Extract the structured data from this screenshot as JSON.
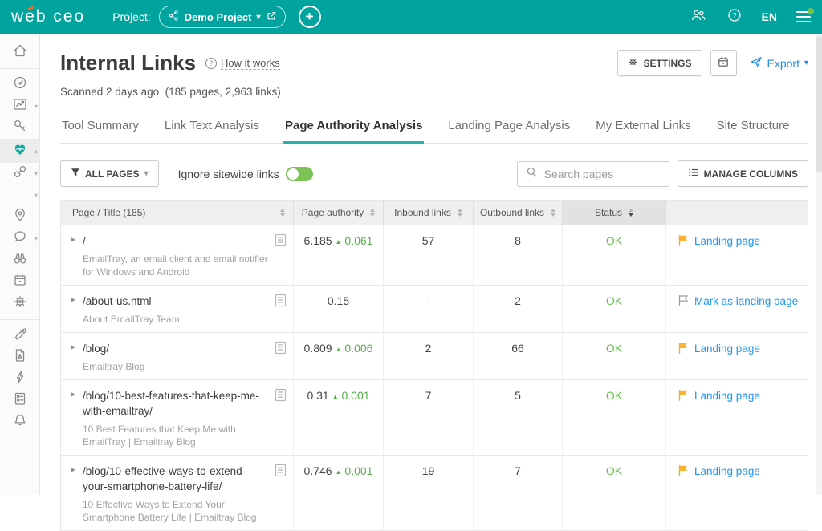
{
  "colors": {
    "brand_teal": "#00a39d",
    "ok_green": "#67bf4c",
    "delta_green": "#56b14a",
    "link_blue": "#2196f3",
    "flag_yellow": "#f9b234",
    "toggle_green": "#7cc356"
  },
  "topbar": {
    "logo": "web ceo",
    "project_label": "Project:",
    "project_name": "Demo Project",
    "language": "EN",
    "icons": [
      "share-icon",
      "chevron-down-icon",
      "external-link-icon",
      "plus-icon",
      "users-icon",
      "help-icon",
      "menu-icon"
    ]
  },
  "sidebar": {
    "icons": [
      {
        "name": "home",
        "caret": "",
        "active": false,
        "divider_after": true
      },
      {
        "name": "dashboard-gauge",
        "caret": "",
        "active": false,
        "divider_after": false
      },
      {
        "name": "rankings-chart",
        "caret": "down",
        "active": false,
        "divider_after": false
      },
      {
        "name": "keywords-key",
        "caret": "",
        "active": false,
        "divider_after": false
      },
      {
        "name": "site-health-heart",
        "caret": "up",
        "active": true,
        "divider_after": false
      },
      {
        "name": "links-chain",
        "caret": "down",
        "active": false,
        "divider_after": false
      },
      {
        "name": "traffic-bars",
        "caret": "down",
        "active": false,
        "divider_after": false
      },
      {
        "name": "local-pin",
        "caret": "",
        "active": false,
        "divider_after": false
      },
      {
        "name": "social-chat",
        "caret": "down",
        "active": false,
        "divider_after": false
      },
      {
        "name": "competitors-binoculars",
        "caret": "",
        "active": false,
        "divider_after": false
      },
      {
        "name": "calendar",
        "caret": "",
        "active": false,
        "divider_after": false
      },
      {
        "name": "settings-gear",
        "caret": "",
        "active": false,
        "divider_after": true
      },
      {
        "name": "rocket",
        "caret": "",
        "active": false,
        "divider_after": false
      },
      {
        "name": "pdf-report",
        "caret": "",
        "active": false,
        "divider_after": false
      },
      {
        "name": "bolt",
        "caret": "",
        "active": false,
        "divider_after": false
      },
      {
        "name": "checklist",
        "caret": "",
        "active": false,
        "divider_after": false
      },
      {
        "name": "bell",
        "caret": "",
        "active": false,
        "divider_after": false
      }
    ]
  },
  "header": {
    "title": "Internal Links",
    "how_it_works": "How it works",
    "scanned": "Scanned 2 days ago",
    "stats": "(185 pages, 2,963 links)",
    "settings_label": "SETTINGS",
    "export_label": "Export"
  },
  "tabs": [
    {
      "label": "Tool Summary",
      "active": false
    },
    {
      "label": "Link Text Analysis",
      "active": false
    },
    {
      "label": "Page Authority Analysis",
      "active": true
    },
    {
      "label": "Landing Page Analysis",
      "active": false
    },
    {
      "label": "My External Links",
      "active": false
    },
    {
      "label": "Site Structure",
      "active": false
    }
  ],
  "filters": {
    "all_pages_label": "ALL PAGES",
    "ignore_sitewide_label": "Ignore sitewide links",
    "toggle_on": true,
    "search_placeholder": "Search pages",
    "manage_columns_label": "MANAGE COLUMNS"
  },
  "table": {
    "columns": [
      {
        "label": "Page / Title (185)",
        "sorted": false,
        "align": "left"
      },
      {
        "label": "Page authority",
        "sorted": false,
        "align": "center"
      },
      {
        "label": "Inbound links",
        "sorted": false,
        "align": "center"
      },
      {
        "label": "Outbound links",
        "sorted": false,
        "align": "center"
      },
      {
        "label": "Status",
        "sorted": true,
        "align": "center"
      }
    ],
    "rows": [
      {
        "page": "/",
        "title": "EmailTray, an email client and email notifier for Windows and Android",
        "authority": "6.185",
        "delta": "0.061",
        "inbound": "57",
        "outbound": "8",
        "status": "OK",
        "action": "Landing page",
        "flagged": true
      },
      {
        "page": "/about-us.html",
        "title": "About EmailTray Team",
        "authority": "0.15",
        "delta": "",
        "inbound": "-",
        "outbound": "2",
        "status": "OK",
        "action": "Mark as landing page",
        "flagged": false
      },
      {
        "page": "/blog/",
        "title": "Emailtray Blog",
        "authority": "0.809",
        "delta": "0.006",
        "inbound": "2",
        "outbound": "66",
        "status": "OK",
        "action": "Landing page",
        "flagged": true
      },
      {
        "page": "/blog/10-best-features-that-keep-me-with-emailtray/",
        "title": "10 Best Features that Keep Me with EmailTray | Emailtray Blog",
        "authority": "0.31",
        "delta": "0.001",
        "inbound": "7",
        "outbound": "5",
        "status": "OK",
        "action": "Landing page",
        "flagged": true
      },
      {
        "page": "/blog/10-effective-ways-to-extend-your-smartphone-battery-life/",
        "title": "10 Effective Ways to Extend Your Smartphone Battery Life | Emailtray Blog",
        "authority": "0.746",
        "delta": "0.001",
        "inbound": "19",
        "outbound": "7",
        "status": "OK",
        "action": "Landing page",
        "flagged": true
      }
    ]
  }
}
